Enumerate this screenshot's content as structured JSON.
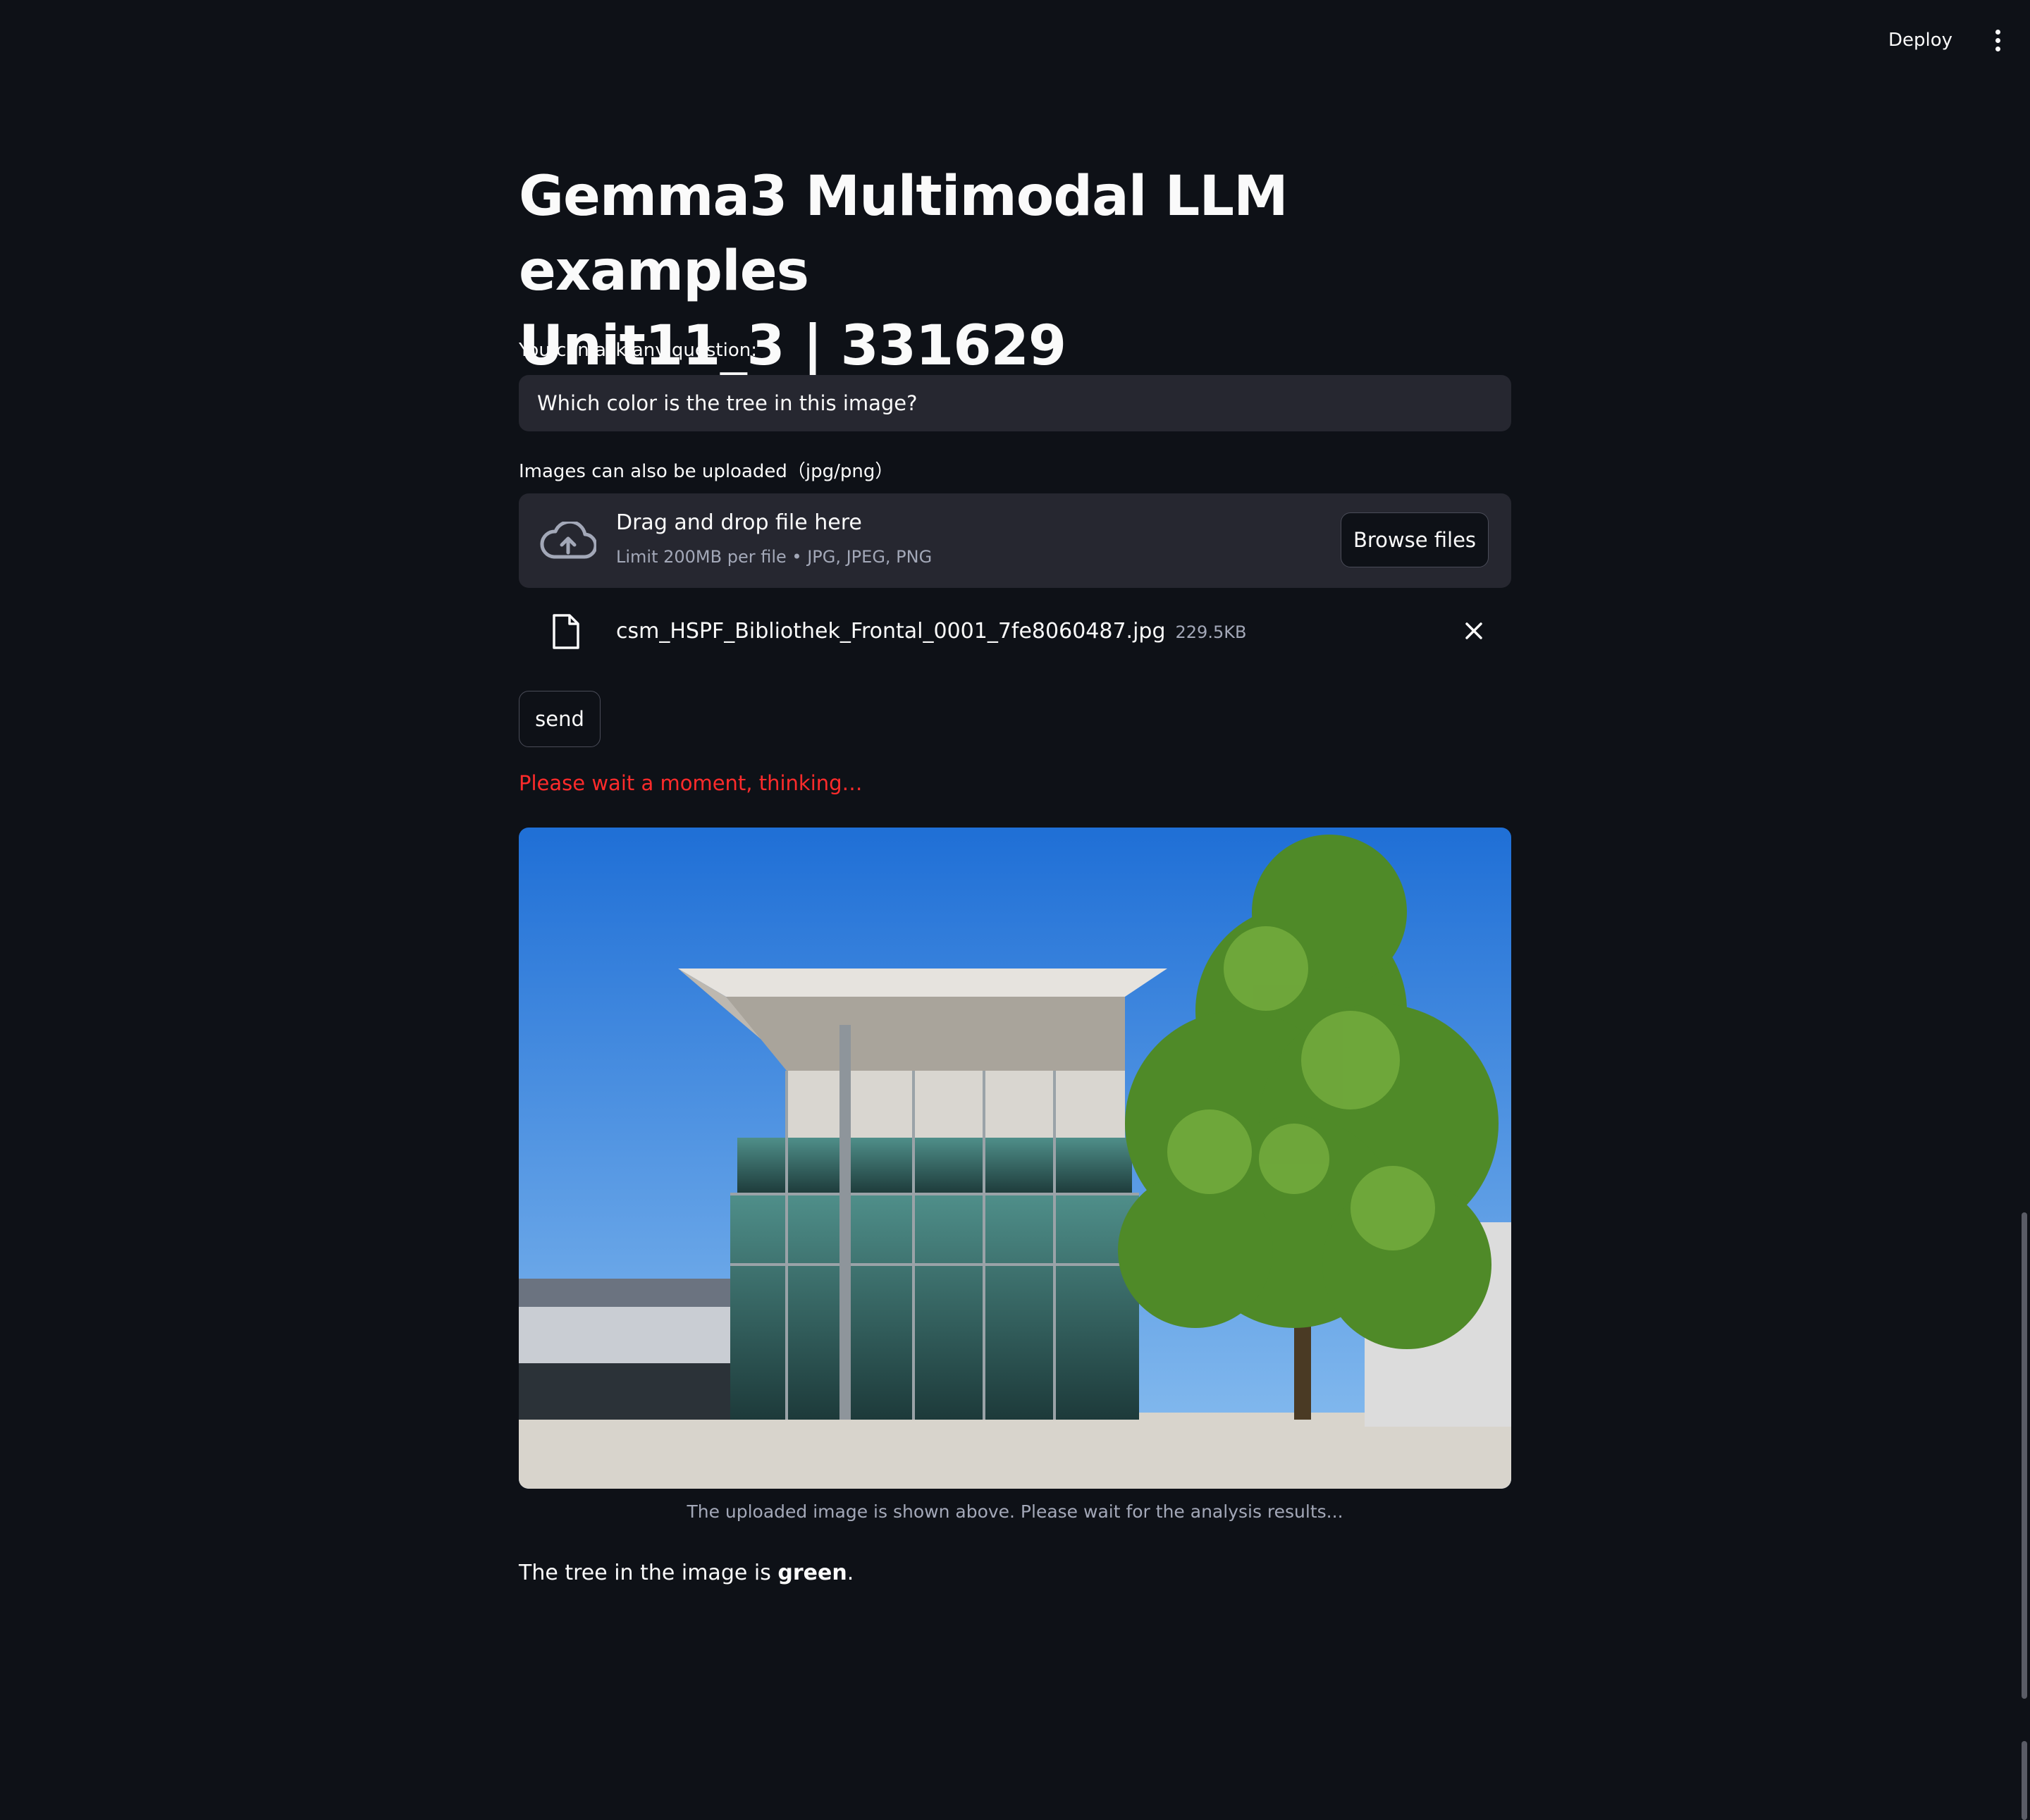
{
  "header": {
    "deploy_label": "Deploy",
    "menu_icon": "kebab-menu-icon"
  },
  "main": {
    "title_line1": "Gemma3 Multimodal LLM examples",
    "title_line2": "Unit11_3 | 331629",
    "question_label": "You can ask any question:",
    "question_value": "Which color is the tree in this image?",
    "upload_label": "Images can also be uploaded（jpg/png）",
    "dropzone_title": "Drag and drop file here",
    "dropzone_sub": "Limit 200MB per file • JPG, JPEG, PNG",
    "browse_label": "Browse files",
    "file": {
      "name": "csm_HSPF_Bibliothek_Frontal_0001_7fe8060487.jpg",
      "size": "229.5KB"
    },
    "send_label": "send",
    "status_text": "Please wait a moment, thinking…",
    "caption": "The uploaded image is shown above. Please wait for the analysis results...",
    "answer_prefix": "The tree in the image is ",
    "answer_bold": "green",
    "answer_suffix": "."
  },
  "colors": {
    "background": "#0e1117",
    "input_bg": "#262730",
    "status_red": "#ff2b2b",
    "muted_text": "#a3a8b8"
  }
}
